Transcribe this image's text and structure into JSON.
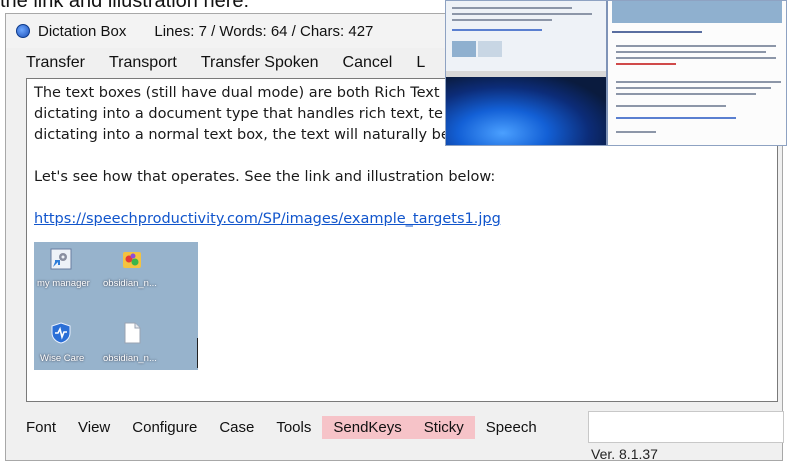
{
  "background": {
    "partial_text": "the link and illustration here:"
  },
  "window": {
    "title": "Dictation Box",
    "stats": "Lines: 7 / Words: 64 / Chars: 427"
  },
  "menu": {
    "items": [
      {
        "label": "Transfer"
      },
      {
        "label": "Transport"
      },
      {
        "label": "Transfer Spoken"
      },
      {
        "label": "Cancel"
      },
      {
        "label": "L"
      }
    ]
  },
  "editor": {
    "lines": [
      "The text boxes (still have dual mode) are both Rich Text",
      "dictating into a document type that handles rich text, te",
      "dictating into a normal text box, the text will naturally be converted to the default text style."
    ],
    "line4": "Let's see how that operates. See the link and illustration below:",
    "link": "https://speechproductivity.com/SP/images/example_targets1.jpg",
    "desktop_icons": [
      {
        "label": "my manager",
        "icon": "gear-shortcut-icon"
      },
      {
        "label": "obsidian_n...",
        "icon": "app-folder-icon"
      },
      {
        "label": "Wise Care",
        "icon": "wise-care-icon"
      },
      {
        "label": "obsidian_n...",
        "icon": "document-icon"
      }
    ]
  },
  "bottom": {
    "items": [
      {
        "label": "Font",
        "highlight": false
      },
      {
        "label": "View",
        "highlight": false
      },
      {
        "label": "Configure",
        "highlight": false
      },
      {
        "label": "Case",
        "highlight": false
      },
      {
        "label": "Tools",
        "highlight": false
      },
      {
        "label": "SendKeys",
        "highlight": true
      },
      {
        "label": "Sticky",
        "highlight": true
      },
      {
        "label": "Speech",
        "highlight": false
      }
    ],
    "input_value": "",
    "version": "Ver. 8.1.37"
  },
  "colors": {
    "highlight": "#f6c3c8",
    "link": "#1155cc",
    "desktop_bg": "#97b3cc"
  }
}
